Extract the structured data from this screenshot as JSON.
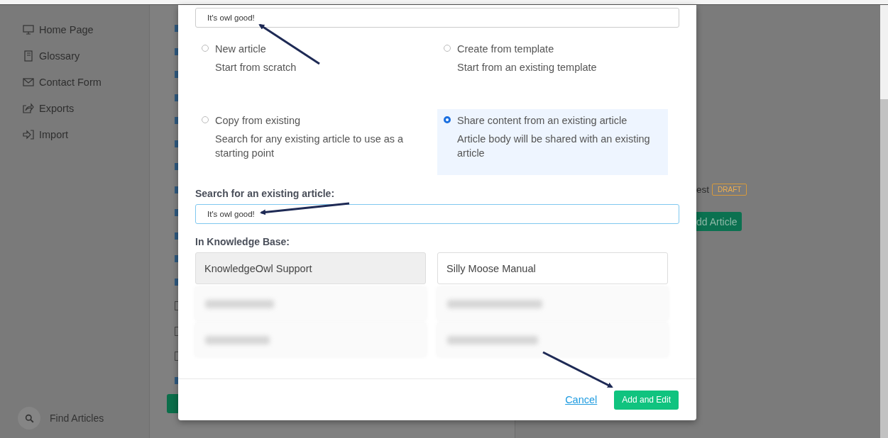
{
  "sidebar": {
    "items": [
      {
        "label": "Home Page"
      },
      {
        "label": "Glossary"
      },
      {
        "label": "Contact Form"
      },
      {
        "label": "Exports"
      },
      {
        "label": "Import"
      }
    ],
    "find": "Find Articles"
  },
  "background": {
    "title_fragment": "est",
    "badge": "DRAFT",
    "button": "dd Article"
  },
  "modal": {
    "title_value": "It's owl good!",
    "options": [
      {
        "label": "New article",
        "description": "Start from scratch",
        "selected": false
      },
      {
        "label": "Create from template",
        "description": "Start from an existing template",
        "selected": false
      },
      {
        "label": "Copy from existing",
        "description": "Search for any existing article to use as a starting point",
        "selected": false
      },
      {
        "label": "Share content from an existing article",
        "description": "Article body will be shared with an existing article",
        "selected": true
      }
    ],
    "search_label": "Search for an existing article:",
    "search_value": "It's owl good!",
    "kb_label": "In Knowledge Base:",
    "knowledge_bases": [
      {
        "label": "KnowledgeOwl Support",
        "selected": true
      },
      {
        "label": "Silly Moose Manual",
        "selected": false
      }
    ],
    "cancel": "Cancel",
    "submit": "Add and Edit"
  }
}
